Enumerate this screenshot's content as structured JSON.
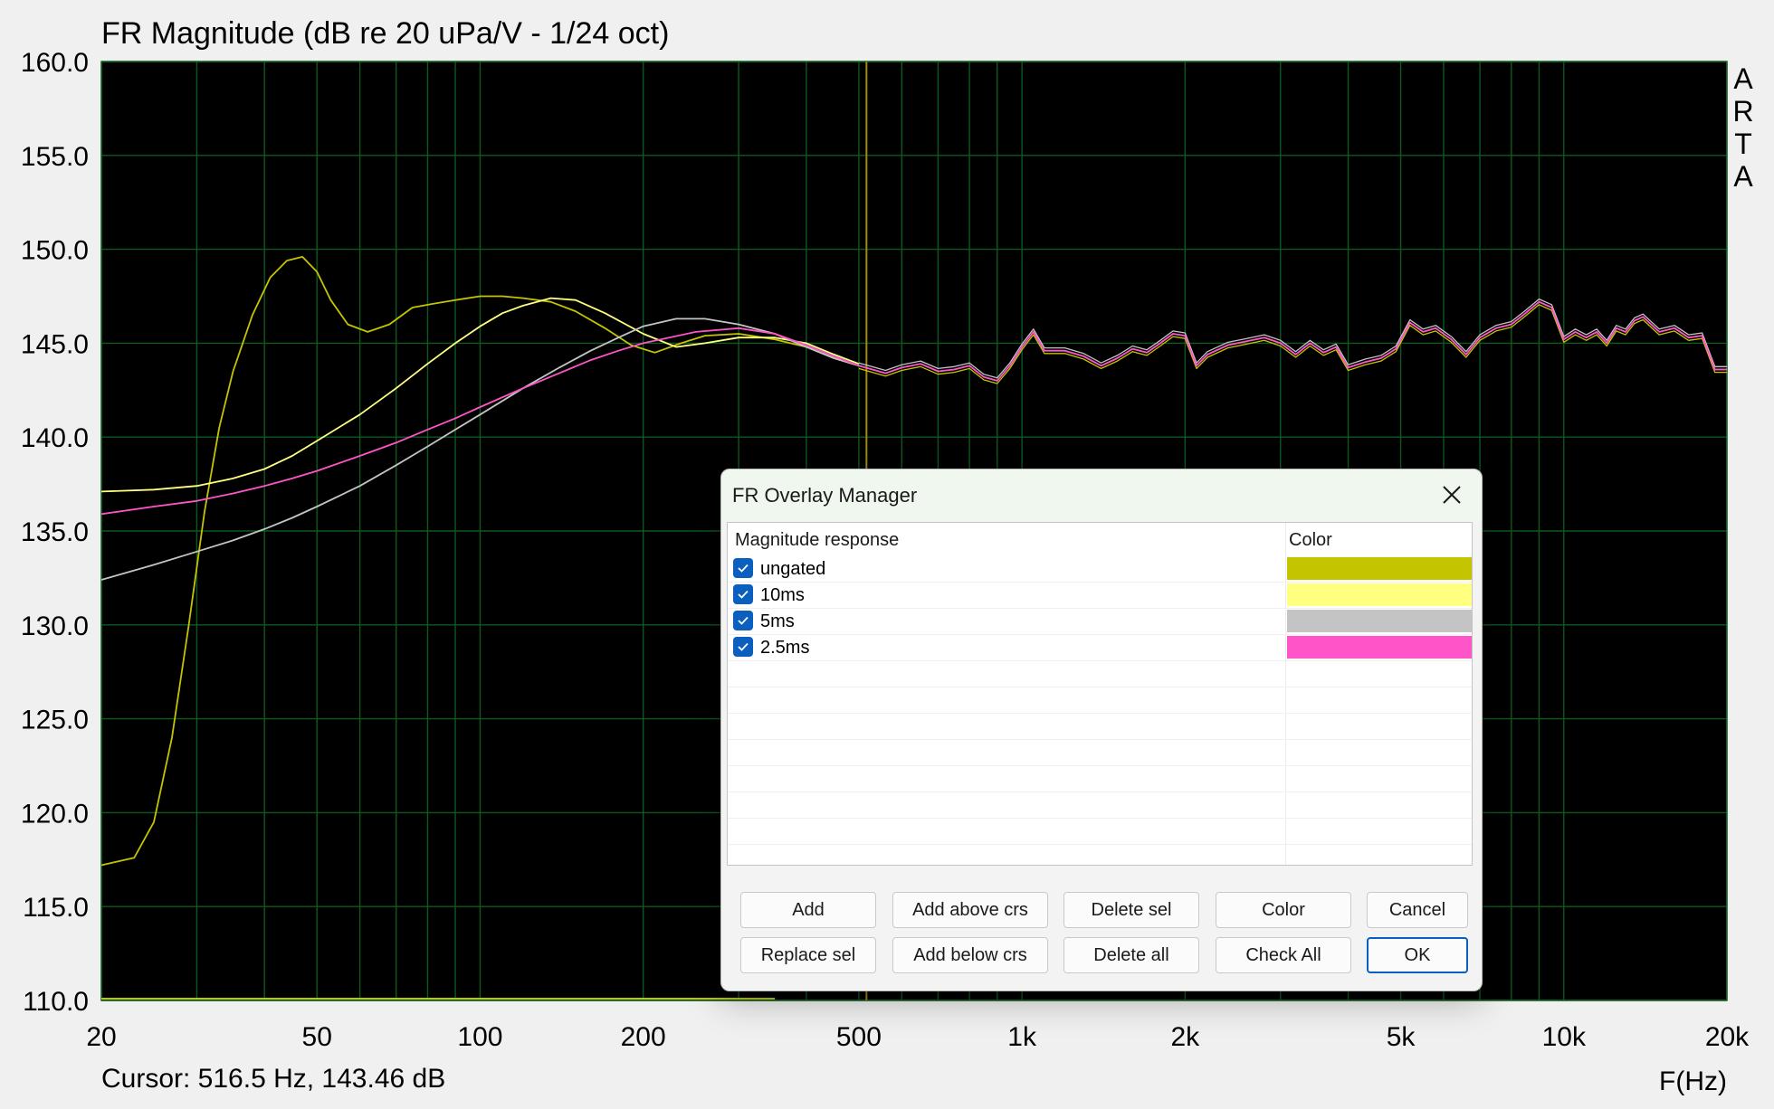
{
  "chart_data": {
    "type": "line",
    "title": "FR Magnitude (dB re 20 uPa/V - 1/24 oct)",
    "xlabel": "F(Hz)",
    "ylabel": "",
    "xscale": "log",
    "xlim": [
      20,
      20000
    ],
    "ylim": [
      110,
      160
    ],
    "grid": true,
    "background": "#000000",
    "grid_color": "#0b5a1e",
    "y_ticks": [
      "160.0",
      "155.0",
      "150.0",
      "145.0",
      "140.0",
      "135.0",
      "130.0",
      "125.0",
      "120.0",
      "115.0",
      "110.0"
    ],
    "x_ticks": [
      {
        "value": 20,
        "label": "20"
      },
      {
        "value": 50,
        "label": "50"
      },
      {
        "value": 100,
        "label": "100"
      },
      {
        "value": 200,
        "label": "200"
      },
      {
        "value": 500,
        "label": "500"
      },
      {
        "value": 1000,
        "label": "1k"
      },
      {
        "value": 2000,
        "label": "2k"
      },
      {
        "value": 5000,
        "label": "5k"
      },
      {
        "value": 10000,
        "label": "10k"
      },
      {
        "value": 20000,
        "label": "20k"
      }
    ],
    "side_label": [
      "A",
      "R",
      "T",
      "A"
    ],
    "cursor": {
      "x": 516.5,
      "y": 143.46,
      "color": "#9c8a1a"
    },
    "series": [
      {
        "name": "ungated",
        "color": "#c4c400",
        "x": [
          20,
          23,
          25,
          27,
          29,
          31,
          33,
          35,
          38,
          41,
          44,
          47,
          50,
          53,
          57,
          62,
          68,
          75,
          82,
          90,
          100,
          110,
          120,
          135,
          150,
          170,
          190,
          210,
          235,
          260,
          300,
          350,
          400,
          450,
          500
        ],
        "y": [
          117.2,
          117.6,
          119.5,
          124,
          130,
          136,
          140.5,
          143.5,
          146.5,
          148.5,
          149.4,
          149.6,
          148.8,
          147.3,
          146,
          145.6,
          146,
          146.9,
          147.1,
          147.3,
          147.5,
          147.5,
          147.4,
          147.2,
          146.7,
          145.8,
          144.9,
          144.5,
          145.0,
          145.4,
          145.5,
          145.2,
          144.8,
          144.2,
          143.8
        ]
      },
      {
        "name": "10ms",
        "color": "#ffff80",
        "x": [
          20,
          25,
          30,
          35,
          40,
          45,
          50,
          60,
          70,
          80,
          90,
          100,
          110,
          120,
          135,
          150,
          170,
          200,
          230,
          260,
          300,
          350,
          400,
          450,
          500
        ],
        "y": [
          137.1,
          137.2,
          137.4,
          137.8,
          138.3,
          139.0,
          139.8,
          141.2,
          142.6,
          143.9,
          145.0,
          145.9,
          146.6,
          147.0,
          147.4,
          147.3,
          146.6,
          145.5,
          144.8,
          145.0,
          145.3,
          145.3,
          145.0,
          144.4,
          143.9
        ]
      },
      {
        "name": "5ms",
        "color": "#c4c4c4",
        "x": [
          20,
          25,
          30,
          35,
          40,
          45,
          50,
          60,
          70,
          80,
          90,
          100,
          120,
          140,
          160,
          180,
          200,
          230,
          260,
          300,
          350,
          400,
          450,
          500
        ],
        "y": [
          132.4,
          133.2,
          133.9,
          134.5,
          135.1,
          135.7,
          136.3,
          137.4,
          138.5,
          139.5,
          140.4,
          141.2,
          142.6,
          143.7,
          144.6,
          145.3,
          145.9,
          146.3,
          146.3,
          146.0,
          145.5,
          144.8,
          144.2,
          143.8
        ]
      },
      {
        "name": "2.5ms",
        "color": "#ff55c8",
        "x": [
          20,
          25,
          30,
          35,
          40,
          45,
          50,
          60,
          70,
          80,
          90,
          100,
          120,
          140,
          160,
          180,
          200,
          250,
          300,
          350,
          400,
          450,
          500
        ],
        "y": [
          135.9,
          136.3,
          136.6,
          137.0,
          137.4,
          137.8,
          138.2,
          139.0,
          139.7,
          140.4,
          141.0,
          141.6,
          142.6,
          143.4,
          144.1,
          144.6,
          145.0,
          145.6,
          145.8,
          145.5,
          144.9,
          144.3,
          143.8
        ]
      }
    ],
    "merged_series": {
      "color": "#ff55c8",
      "note_colors": [
        "#c4c400",
        "#ffff80",
        "#c4c4c4"
      ],
      "x": [
        500,
        560,
        600,
        650,
        700,
        750,
        800,
        850,
        900,
        950,
        1000,
        1050,
        1100,
        1200,
        1300,
        1400,
        1500,
        1600,
        1700,
        1800,
        1900,
        2000,
        2100,
        2200,
        2400,
        2600,
        2800,
        3000,
        3200,
        3400,
        3600,
        3800,
        4000,
        4300,
        4600,
        4900,
        5200,
        5500,
        5800,
        6200,
        6600,
        7000,
        7500,
        8000,
        8500,
        9000,
        9500,
        10000,
        10500,
        11000,
        11500,
        12000,
        12500,
        13000,
        13500,
        14000,
        15000,
        16000,
        17000,
        18000,
        19000,
        20000
      ],
      "y": [
        143.8,
        143.4,
        143.7,
        143.9,
        143.5,
        143.6,
        143.8,
        143.2,
        143.0,
        143.8,
        144.8,
        145.6,
        144.6,
        144.6,
        144.3,
        143.8,
        144.2,
        144.7,
        144.5,
        145.0,
        145.5,
        145.4,
        143.8,
        144.4,
        144.9,
        145.1,
        145.3,
        145.0,
        144.4,
        145.0,
        144.5,
        144.8,
        143.7,
        144.0,
        144.2,
        144.7,
        146.1,
        145.6,
        145.8,
        145.2,
        144.4,
        145.3,
        145.8,
        146.0,
        146.6,
        147.2,
        146.9,
        145.2,
        145.6,
        145.3,
        145.6,
        145.0,
        145.8,
        145.6,
        146.2,
        146.4,
        145.6,
        145.8,
        145.3,
        145.4,
        143.6,
        143.6
      ]
    }
  },
  "cursor_readout": "Cursor: 516.5 Hz, 143.46 dB",
  "dialog": {
    "title": "FR Overlay Manager",
    "columns": {
      "name": "Magnitude response",
      "color": "Color"
    },
    "items": [
      {
        "label": "ungated",
        "checked": true,
        "color": "#c4c400"
      },
      {
        "label": "10ms",
        "checked": true,
        "color": "#ffff80"
      },
      {
        "label": "5ms",
        "checked": true,
        "color": "#c4c4c4"
      },
      {
        "label": "2.5ms",
        "checked": true,
        "color": "#ff55c8"
      }
    ],
    "buttons": {
      "add": "Add",
      "add_above": "Add above crs",
      "delete_sel": "Delete sel",
      "color": "Color",
      "cancel": "Cancel",
      "replace_sel": "Replace sel",
      "add_below": "Add below crs",
      "delete_all": "Delete all",
      "check_all": "Check All",
      "ok": "OK"
    }
  }
}
